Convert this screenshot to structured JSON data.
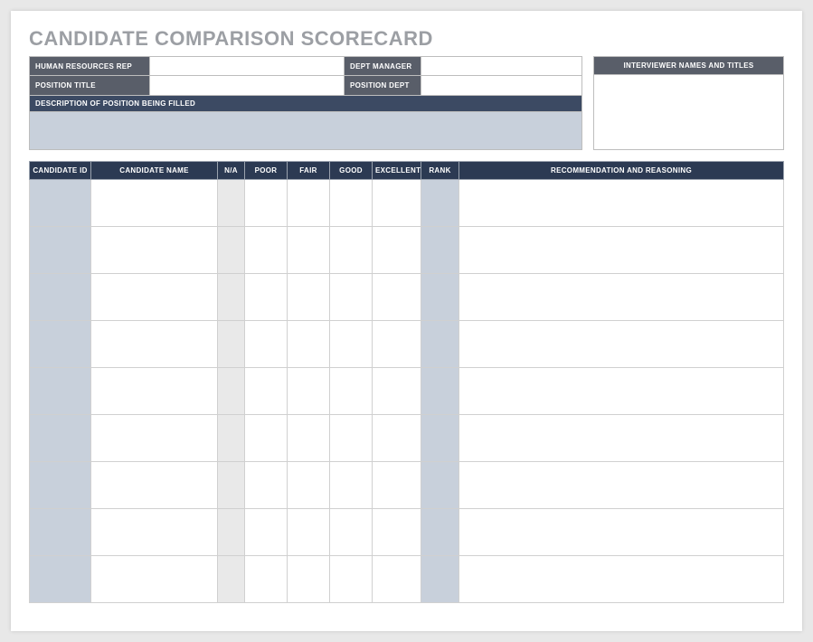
{
  "title": "CANDIDATE COMPARISON SCORECARD",
  "top": {
    "hr_rep_label": "HUMAN RESOURCES REP",
    "hr_rep_value": "",
    "dept_manager_label": "DEPT MANAGER",
    "dept_manager_value": "",
    "position_title_label": "POSITION TITLE",
    "position_title_value": "",
    "position_dept_label": "POSITION DEPT",
    "position_dept_value": "",
    "description_label": "DESCRIPTION OF POSITION BEING FILLED",
    "description_value": "",
    "interviewer_label": "INTERVIEWER NAMES AND TITLES",
    "interviewer_value": ""
  },
  "table": {
    "headers": {
      "id": "CANDIDATE ID",
      "name": "CANDIDATE NAME",
      "na": "N/A",
      "poor": "POOR",
      "fair": "FAIR",
      "good": "GOOD",
      "excellent": "EXCELLENT",
      "rank": "RANK",
      "recommendation": "RECOMMENDATION AND REASONING"
    },
    "rows": [
      {
        "id": "",
        "name": "",
        "na": "",
        "poor": "",
        "fair": "",
        "good": "",
        "excellent": "",
        "rank": "",
        "recommendation": ""
      },
      {
        "id": "",
        "name": "",
        "na": "",
        "poor": "",
        "fair": "",
        "good": "",
        "excellent": "",
        "rank": "",
        "recommendation": ""
      },
      {
        "id": "",
        "name": "",
        "na": "",
        "poor": "",
        "fair": "",
        "good": "",
        "excellent": "",
        "rank": "",
        "recommendation": ""
      },
      {
        "id": "",
        "name": "",
        "na": "",
        "poor": "",
        "fair": "",
        "good": "",
        "excellent": "",
        "rank": "",
        "recommendation": ""
      },
      {
        "id": "",
        "name": "",
        "na": "",
        "poor": "",
        "fair": "",
        "good": "",
        "excellent": "",
        "rank": "",
        "recommendation": ""
      },
      {
        "id": "",
        "name": "",
        "na": "",
        "poor": "",
        "fair": "",
        "good": "",
        "excellent": "",
        "rank": "",
        "recommendation": ""
      },
      {
        "id": "",
        "name": "",
        "na": "",
        "poor": "",
        "fair": "",
        "good": "",
        "excellent": "",
        "rank": "",
        "recommendation": ""
      },
      {
        "id": "",
        "name": "",
        "na": "",
        "poor": "",
        "fair": "",
        "good": "",
        "excellent": "",
        "rank": "",
        "recommendation": ""
      },
      {
        "id": "",
        "name": "",
        "na": "",
        "poor": "",
        "fair": "",
        "good": "",
        "excellent": "",
        "rank": "",
        "recommendation": ""
      }
    ]
  }
}
